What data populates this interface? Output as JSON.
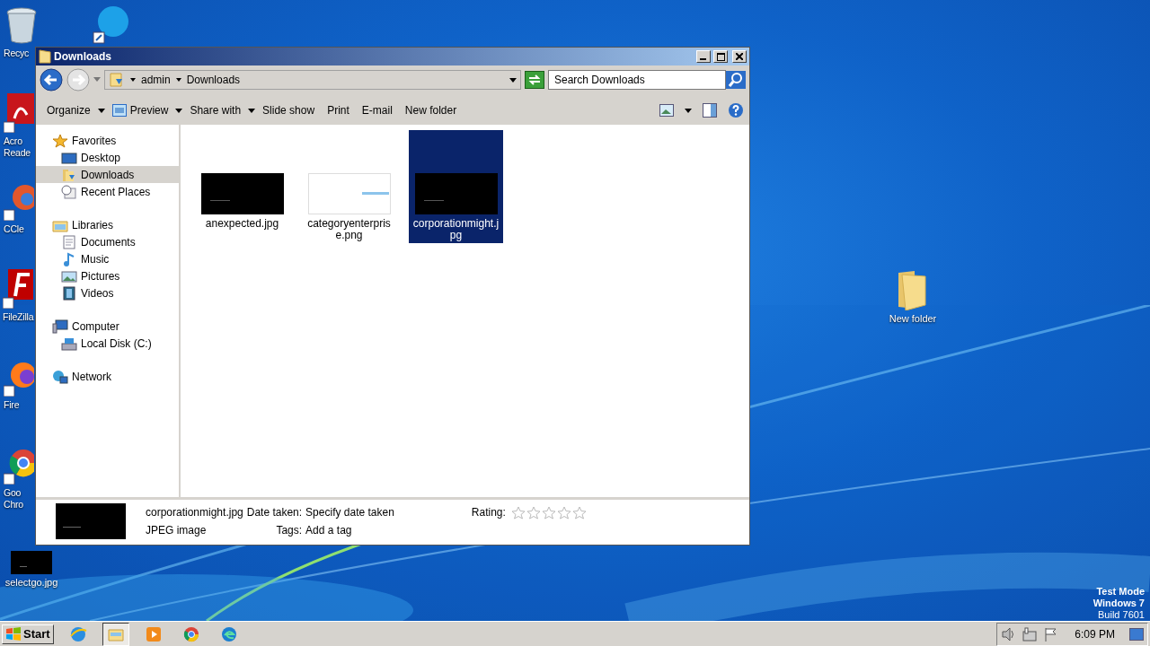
{
  "desktop": {
    "icons": [
      {
        "kind": "recycle",
        "label": "Recyc"
      },
      {
        "kind": "chat"
      },
      {
        "kind": "pdf",
        "label": "Acro Reade"
      },
      {
        "kind": "cleaner",
        "label": "CCle"
      },
      {
        "kind": "ftp",
        "label": "FileZilla"
      },
      {
        "kind": "fox",
        "label": "Fire"
      },
      {
        "kind": "chrome",
        "label": "Goo Chro"
      },
      {
        "label": "selectgo.jpg"
      },
      {
        "kind": "folder",
        "label": "New folder"
      }
    ],
    "os_notice": [
      "Test Mode",
      "Windows 7",
      "Build 7601"
    ]
  },
  "window": {
    "title": "Downloads",
    "breadcrumb": [
      "admin",
      "Downloads"
    ],
    "search": {
      "placeholder": "Search Downloads"
    },
    "toolbar": [
      {
        "label": "Organize",
        "kind": "menu"
      },
      {
        "label": "Preview",
        "kind": "icon-menu"
      },
      {
        "label": "Share with",
        "kind": "menu"
      },
      {
        "label": "Slide show",
        "kind": "command"
      },
      {
        "label": "Print",
        "kind": "command"
      },
      {
        "label": "E-mail",
        "kind": "command"
      },
      {
        "label": "New folder",
        "kind": "command"
      }
    ],
    "nav": [
      {
        "label": "Favorites",
        "kind": "star",
        "selected": false,
        "children": [
          {
            "label": "Desktop",
            "kind": "desktop",
            "selected": false
          },
          {
            "label": "Downloads",
            "kind": "downloads",
            "selected": true
          },
          {
            "label": "Recent Places",
            "kind": "recent",
            "selected": false
          }
        ]
      },
      {
        "label": "Libraries",
        "kind": "libraries",
        "selected": false,
        "children": [
          {
            "label": "Documents",
            "kind": "documents",
            "selected": false
          },
          {
            "label": "Music",
            "kind": "music",
            "selected": false
          },
          {
            "label": "Pictures",
            "kind": "pictures",
            "selected": false
          },
          {
            "label": "Videos",
            "kind": "videos",
            "selected": false
          }
        ]
      },
      {
        "label": "Computer",
        "kind": "computer",
        "selected": false,
        "children": [
          {
            "label": "Local Disk (C:)",
            "kind": "disk",
            "selected": false
          }
        ]
      },
      {
        "label": "Network",
        "kind": "network",
        "selected": false
      }
    ],
    "files": [
      {
        "name": "anexpected.jpg",
        "kind": "dark",
        "selected": false
      },
      {
        "name": "categoryenterprise.png",
        "kind": "light",
        "selected": false
      },
      {
        "name": "corporationmight.jpg",
        "kind": "dark",
        "selected": true
      }
    ],
    "details": {
      "name": "corporationmight.jpg",
      "type": "JPEG image",
      "fields": [
        {
          "label": "Date taken:",
          "value": "Specify date taken"
        },
        {
          "label": "Tags:",
          "value": "Add a tag"
        }
      ],
      "rating": {
        "label": "Rating:",
        "stars": 0
      }
    }
  },
  "taskbar": {
    "start": "Start",
    "apps": [
      {
        "kind": "ie",
        "selected": false
      },
      {
        "kind": "explorer",
        "selected": true
      },
      {
        "kind": "media",
        "selected": false
      },
      {
        "kind": "chrome",
        "selected": false
      },
      {
        "kind": "edge",
        "selected": false
      }
    ],
    "time": "6:09 PM"
  }
}
